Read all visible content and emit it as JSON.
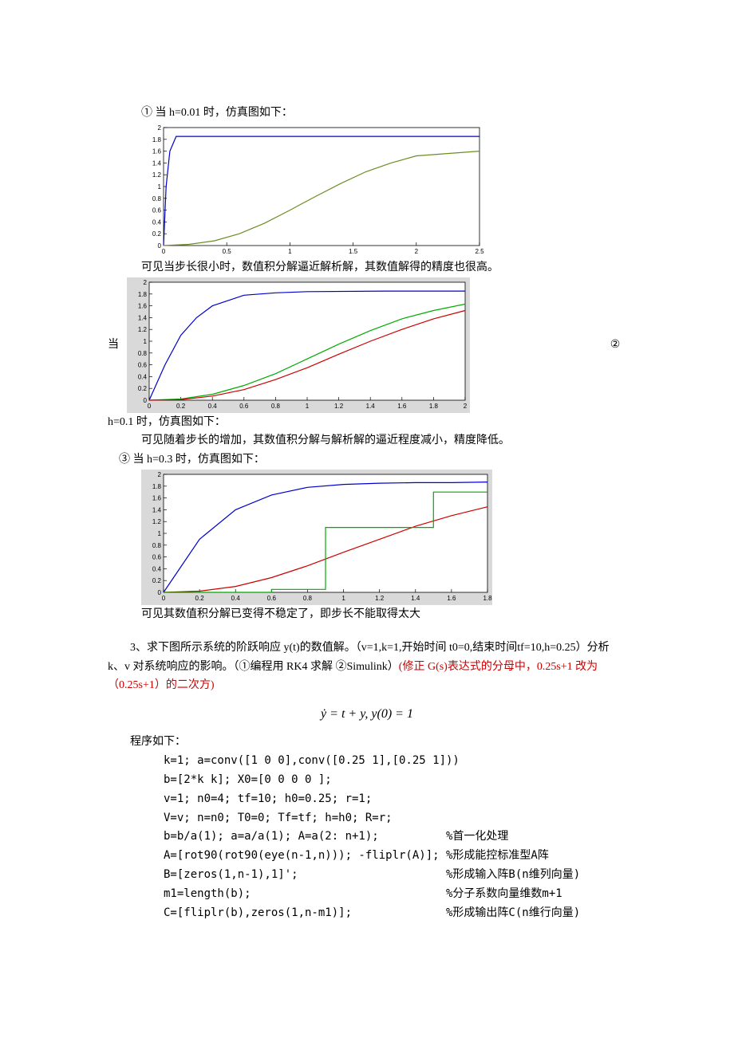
{
  "section1": {
    "title": "① 当 h=0.01 时，仿真图如下：",
    "conclusion": "可见当步长很小时，数值积分解逼近解析解，其数值解得的精度也很高。"
  },
  "section2": {
    "dang": "当",
    "circled": "②",
    "title_after": "h=0.1 时，仿真图如下：",
    "conclusion": "可见随着步长的增加，其数值积分解与解析解的逼近程度减小，精度降低。"
  },
  "section3": {
    "title": "③ 当 h=0.3 时，仿真图如下：",
    "conclusion": "可见其数值积分解已变得不稳定了，即步长不能取得太大"
  },
  "question3": {
    "prefix": "3、求下图所示系统的阶跃响应 y(t)的数值解。（v=1,k=1,开始时间 t0=0,结束时间tf=10,h=0.25）分析 k、v 对系统响应的影响。（①编程用 RK4 求解 ②Simulink）",
    "red_part": "(修正 G(s)表达式的分母中，0.25s+1 改为（0.25s+1）的二次方)"
  },
  "formula": "ẏ = t + y, y(0) = 1",
  "program_label": "程序如下：",
  "code_lines": [
    {
      "code": "k=1; a=conv([1 0 0],conv([0.25 1],[0.25 1]))",
      "comment": ""
    },
    {
      "code": "b=[2*k k]; X0=[0 0 0 0 ];",
      "comment": ""
    },
    {
      "code": "v=1; n0=4; tf=10; h0=0.25; r=1;",
      "comment": ""
    },
    {
      "code": "V=v; n=n0; T0=0; Tf=tf; h=h0; R=r;",
      "comment": ""
    },
    {
      "code": "b=b/a(1); a=a/a(1); A=a(2: n+1);",
      "comment": "%首一化处理"
    },
    {
      "code": "A=[rot90(rot90(eye(n-1,n))); -fliplr(A)];",
      "comment": "%形成能控标准型A阵"
    },
    {
      "code": "B=[zeros(1,n-1),1]';",
      "comment": "%形成输入阵B(n维列向量)"
    },
    {
      "code": "m1=length(b);",
      "comment": "%分子系数向量维数m+1"
    },
    {
      "code": "C=[fliplr(b),zeros(1,n-m1)];",
      "comment": "%形成输出阵C(n维行向量)"
    }
  ],
  "chart_data": [
    {
      "id": "chart1",
      "type": "line",
      "title": "",
      "xlabel": "",
      "ylabel": "",
      "xlim": [
        0,
        2.5
      ],
      "ylim": [
        0,
        2
      ],
      "xticks": [
        0,
        0.5,
        1,
        1.5,
        2,
        2.5
      ],
      "yticks": [
        0,
        0.2,
        0.4,
        0.6,
        0.8,
        1,
        1.2,
        1.4,
        1.6,
        1.8,
        2
      ],
      "series": [
        {
          "name": "blue",
          "color": "#0000cc",
          "x": [
            0,
            0.02,
            0.05,
            0.1,
            0.5,
            1,
            1.5,
            2,
            2.5
          ],
          "y": [
            0,
            1.0,
            1.6,
            1.85,
            1.85,
            1.85,
            1.85,
            1.85,
            1.85
          ]
        },
        {
          "name": "green",
          "color": "#6b8e23",
          "x": [
            0,
            0.2,
            0.4,
            0.6,
            0.8,
            1,
            1.2,
            1.4,
            1.6,
            1.8,
            2,
            2.5
          ],
          "y": [
            0,
            0.02,
            0.08,
            0.2,
            0.38,
            0.6,
            0.83,
            1.05,
            1.25,
            1.4,
            1.52,
            1.6
          ]
        }
      ]
    },
    {
      "id": "chart2",
      "type": "line",
      "xlim": [
        0,
        2
      ],
      "ylim": [
        0,
        2
      ],
      "xticks": [
        0,
        0.2,
        0.4,
        0.6,
        0.8,
        1,
        1.2,
        1.4,
        1.6,
        1.8,
        2
      ],
      "yticks": [
        0,
        0.2,
        0.4,
        0.6,
        0.8,
        1,
        1.2,
        1.4,
        1.6,
        1.8,
        2
      ],
      "bg": "#d9d9d9",
      "series": [
        {
          "name": "blue",
          "color": "#0000cc",
          "x": [
            0,
            0.1,
            0.2,
            0.3,
            0.4,
            0.6,
            0.8,
            1,
            1.5,
            2
          ],
          "y": [
            0,
            0.6,
            1.1,
            1.4,
            1.6,
            1.78,
            1.82,
            1.84,
            1.85,
            1.85
          ]
        },
        {
          "name": "green",
          "color": "#00aa00",
          "x": [
            0,
            0.2,
            0.4,
            0.6,
            0.8,
            1,
            1.2,
            1.4,
            1.6,
            1.8,
            2
          ],
          "y": [
            0,
            0.02,
            0.1,
            0.25,
            0.45,
            0.7,
            0.95,
            1.18,
            1.38,
            1.52,
            1.63
          ]
        },
        {
          "name": "red",
          "color": "#cc0000",
          "x": [
            0,
            0.2,
            0.4,
            0.6,
            0.8,
            1,
            1.2,
            1.4,
            1.6,
            1.8,
            2
          ],
          "y": [
            0,
            0.01,
            0.07,
            0.18,
            0.35,
            0.55,
            0.78,
            1.0,
            1.2,
            1.38,
            1.52
          ]
        }
      ]
    },
    {
      "id": "chart3",
      "type": "line",
      "xlim": [
        0,
        1.8
      ],
      "ylim": [
        0,
        2
      ],
      "xticks": [
        0,
        0.2,
        0.4,
        0.6,
        0.8,
        1,
        1.2,
        1.4,
        1.6,
        1.8
      ],
      "yticks": [
        0,
        0.2,
        0.4,
        0.6,
        0.8,
        1,
        1.2,
        1.4,
        1.6,
        1.8,
        2
      ],
      "bg": "#d9d9d9",
      "series": [
        {
          "name": "blue",
          "color": "#0000cc",
          "x": [
            0,
            0.2,
            0.4,
            0.6,
            0.8,
            1,
            1.2,
            1.4,
            1.6,
            1.8
          ],
          "y": [
            0,
            0.9,
            1.4,
            1.65,
            1.78,
            1.83,
            1.85,
            1.86,
            1.86,
            1.87
          ]
        },
        {
          "name": "red",
          "color": "#cc0000",
          "x": [
            0,
            0.2,
            0.4,
            0.6,
            0.8,
            1,
            1.2,
            1.4,
            1.6,
            1.8
          ],
          "y": [
            0,
            0.02,
            0.1,
            0.25,
            0.45,
            0.68,
            0.9,
            1.12,
            1.3,
            1.45
          ]
        },
        {
          "name": "green",
          "color": "#00aa00",
          "x": [
            0,
            0.3,
            0.6,
            0.6,
            0.9,
            0.9,
            1.2,
            1.5,
            1.5,
            1.8
          ],
          "y": [
            0,
            0,
            0,
            0.05,
            0.05,
            1.1,
            1.1,
            1.1,
            1.7,
            1.7
          ]
        }
      ]
    }
  ]
}
